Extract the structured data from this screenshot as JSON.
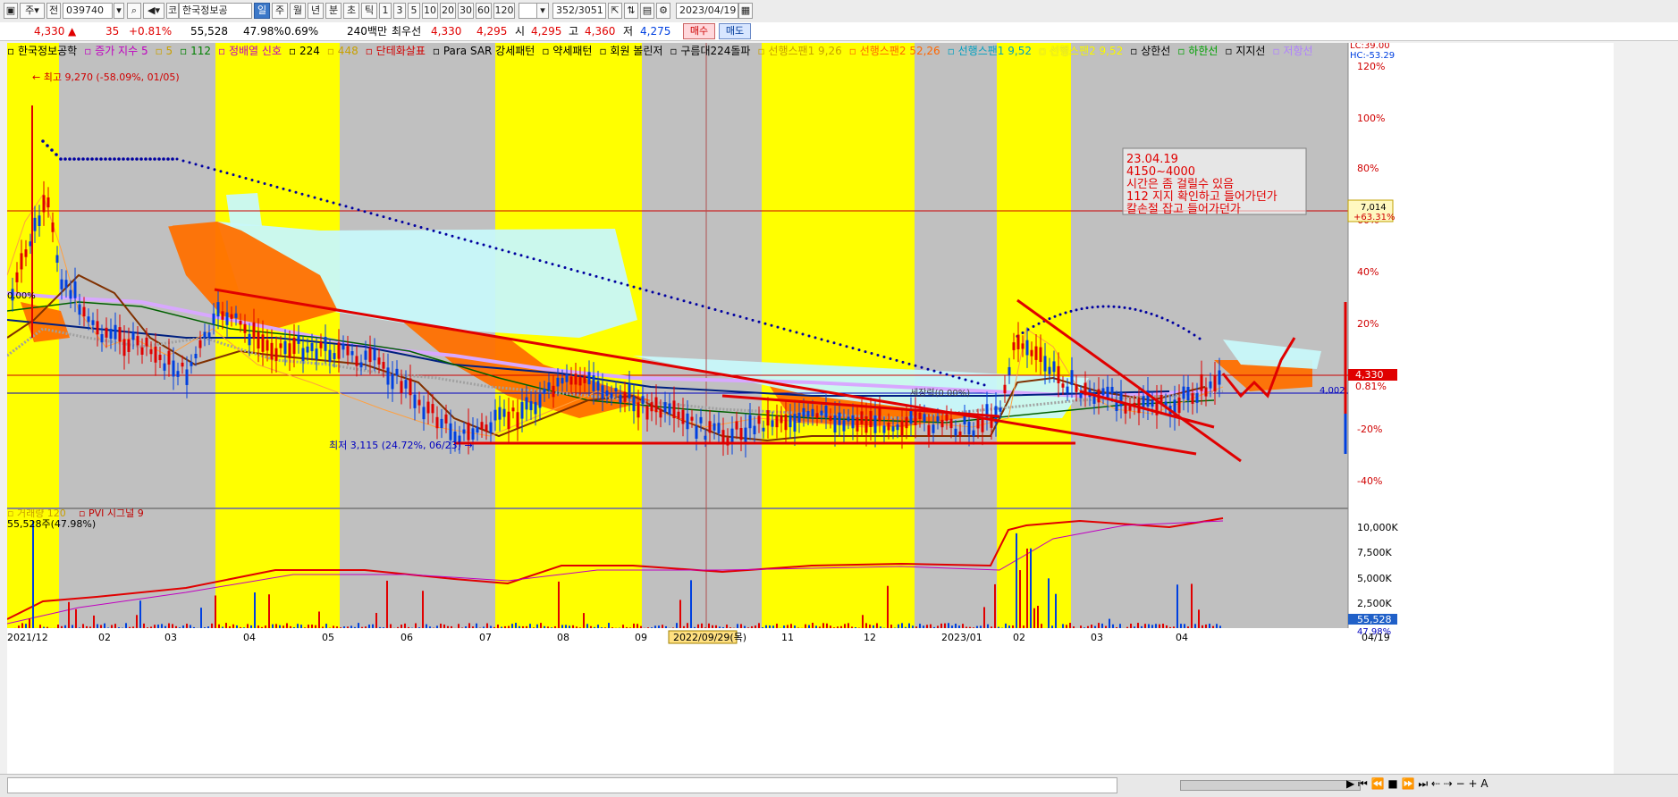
{
  "toolbar": {
    "market_select": "주",
    "all_label": "전",
    "code": "039740",
    "company_button": "코",
    "company": "한국정보공",
    "periods": [
      "일",
      "주",
      "월",
      "년",
      "분",
      "초",
      "틱"
    ],
    "selected_period": "일",
    "intervals": [
      "1",
      "3",
      "5",
      "10",
      "20",
      "30",
      "60",
      "120"
    ],
    "count": "352/3051",
    "date": "2023/04/19",
    "buy_button": "매수",
    "sell_button": "매도"
  },
  "quote": {
    "price": "4,330",
    "change_arrow": "▲",
    "change": "35",
    "change_pct": "+0.81%",
    "volume": "55,528",
    "volume_ratio": "47.98%",
    "turnover": "0.69%",
    "amount": "240백만",
    "priority_label": "최우선",
    "priority_value": "4,330",
    "open_prefix": "4,295",
    "open_label": "시",
    "open": "4,295",
    "high_label": "고",
    "high": "4,360",
    "low_label": "저",
    "low": "4,275"
  },
  "legend": [
    {
      "text": "한국정보공학",
      "color": "#000000"
    },
    {
      "text": "증가 지수 5",
      "color": "#c000c0"
    },
    {
      "text": "5",
      "color": "#c8a000"
    },
    {
      "text": "112",
      "color": "#008000"
    },
    {
      "text": "정배열 신호",
      "color": "#c000c0"
    },
    {
      "text": "224",
      "color": "#000000"
    },
    {
      "text": "448",
      "color": "#c8a000"
    },
    {
      "text": "단테화살표",
      "color": "#d00000"
    },
    {
      "text": "Para SAR 강세패턴",
      "color": "#000000"
    },
    {
      "text": "약세패턴",
      "color": "#000000"
    },
    {
      "text": "회원 볼린저",
      "color": "#000000"
    },
    {
      "text": "구름대224돌파",
      "color": "#000000"
    },
    {
      "text": "선행스팬1 9,26",
      "color": "#c8a000"
    },
    {
      "text": "선행스팬2 52,26",
      "color": "#ff6600"
    },
    {
      "text": "선행스팬1 9,52",
      "color": "#00a0c0"
    },
    {
      "text": "선행스팬2 9,52",
      "color": "#ffff00"
    },
    {
      "text": "상한선",
      "color": "#000000"
    },
    {
      "text": "하한선",
      "color": "#00a000"
    },
    {
      "text": "지지선",
      "color": "#000000"
    },
    {
      "text": "저항선",
      "color": "#b080ff"
    }
  ],
  "right_top": {
    "lc": "LC:39.00",
    "hc": "HC:-53.29"
  },
  "y_axis_pct": [
    "120%",
    "100%",
    "80%",
    "60%",
    "40%",
    "20%",
    "0.81%",
    "-20%",
    "-40%"
  ],
  "price_tags": {
    "ref_price": "7,014",
    "ref_pct": "+63.31%",
    "current": "4,330",
    "support": "4,002",
    "current_pct": "0.81%"
  },
  "annotations": {
    "high": "최고 9,270 (-58.09%, 01/05)",
    "low": "최저 3,115 (24.72%, 06/23)",
    "left_pct": "0.00%",
    "mid_label": "세장력(0.00%)",
    "note_lines": [
      "23.04.19",
      "4150~4000",
      "시간은 좀 걸릴수 있음",
      "112 지지 확인하고 들어가던가",
      "칼손절 잡고 들어가던가"
    ]
  },
  "volume_panel": {
    "legend": [
      "거래량 120",
      "PVI 시그널 9"
    ],
    "legend_colors": [
      "#c8a000",
      "#c00000"
    ],
    "value": "55,528주(47.98%)",
    "y_axis": [
      "10,000K",
      "7,500K",
      "5,000K",
      "2,500K"
    ],
    "tag_volume": "55,528",
    "tag_pct": "47.98%"
  },
  "x_axis": [
    "2021/12",
    "02",
    "03",
    "04",
    "05",
    "06",
    "07",
    "08",
    "09",
    "2022/09/29(목)",
    "11",
    "12",
    "2023/01",
    "02",
    "03",
    "04",
    "04/19"
  ],
  "colors": {
    "yellow": "#ffff00",
    "gray": "#c0c0c0",
    "up": "#e00000",
    "down": "#0040e0",
    "orange": "#ff7000",
    "cyan": "#c8f8fa"
  }
}
